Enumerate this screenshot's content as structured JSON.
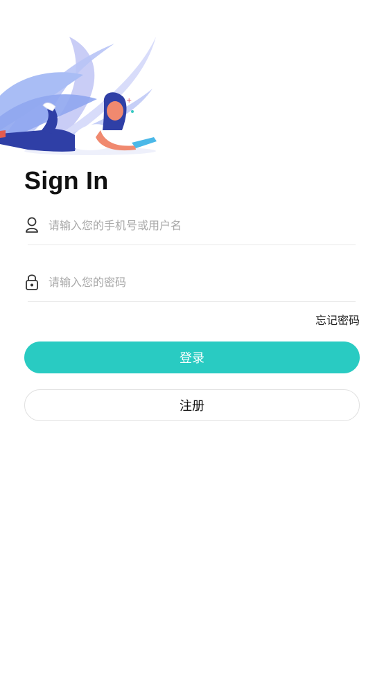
{
  "header": {
    "title": "Sign In"
  },
  "form": {
    "username": {
      "placeholder": "请输入您的手机号或用户名",
      "value": ""
    },
    "password": {
      "placeholder": "请输入您的密码",
      "value": ""
    },
    "forgot_label": "忘记密码"
  },
  "actions": {
    "login_label": "登录",
    "register_label": "注册"
  },
  "icons": {
    "username": "user-icon",
    "password": "lock-icon"
  },
  "colors": {
    "accent": "#29cbc2",
    "title": "#111111",
    "placeholder": "#a8a8a8",
    "divider": "#e8e8e8"
  }
}
